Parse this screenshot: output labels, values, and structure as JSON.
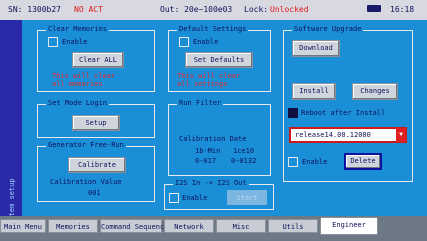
{
  "status": {
    "serial": "SN: 1300b27",
    "alert": "NO ACT",
    "output": "Out: 20e~100e03",
    "lock": "Lock:",
    "unlocked": "Unlocked",
    "time": "16:18"
  },
  "sidebar_label": "System setup",
  "clear_memories": {
    "title": "Clear Memories",
    "enable": "Enable",
    "button": "Clear ALL",
    "warning_line1": "This will clear",
    "warning_line2": "all memories"
  },
  "default_settings": {
    "title": "Default Settings",
    "enable": "Enable",
    "button": "Set Defaults",
    "warning_line1": "This will clear",
    "warning_line2": "all settings"
  },
  "software_upgrade": {
    "title": "Software Upgrade",
    "download": "Download",
    "install": "Install",
    "changes": "Changes",
    "reboot_label": "Reboot after Install",
    "release_value": "release14.00.12000",
    "enable": "Enable",
    "delete": "Delete"
  },
  "set_mode_login": {
    "title": "Set Mode Login",
    "button": "Setup"
  },
  "run_filter": {
    "title": "Run Filter",
    "cal_date_label": "Calibration Date",
    "row1_left": "1b-Min",
    "row1_right": "1ce10",
    "row2_left": "0-017",
    "row2_right": "0-0132"
  },
  "generator_free_run": {
    "title": "Generator Free-Run",
    "button": "Calibrate",
    "cal_value_label": "Calibration Value",
    "cal_value": "001"
  },
  "i2s_out": {
    "title": "I2S In -> I2S Out",
    "enable": "Enable",
    "button": "Start"
  },
  "tabs": [
    "Main Menu",
    "Memories",
    "Command Sequence",
    "Network",
    "Misc",
    "Utils",
    "Engineer"
  ],
  "active_tab": "Engineer"
}
